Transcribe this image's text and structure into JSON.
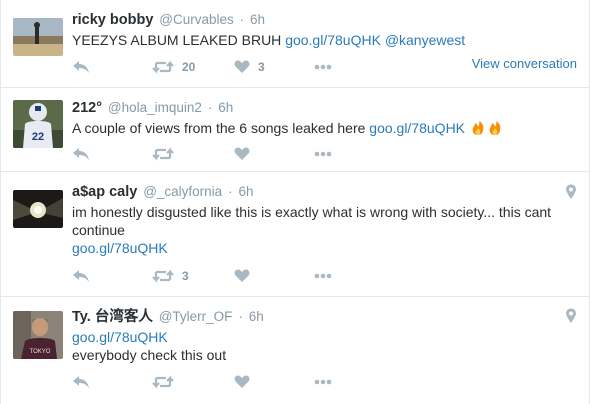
{
  "tweets": [
    {
      "fullname": "ricky bobby",
      "username": "@Curvables",
      "time": "6h",
      "text": "YEEZYS ALBUM LEAKED BRUH ",
      "link": "goo.gl/78uQHK",
      "mention": "@kanyewest",
      "retweets": "20",
      "likes": "3",
      "view_conversation": "View conversation",
      "avatar_icon": "landscape-photo-avatar"
    },
    {
      "fullname": "212°",
      "username": "@hola_imquin2",
      "time": "6h",
      "text": "A couple of views from the 6 songs leaked here ",
      "link": "goo.gl/78uQHK",
      "emoji": "fire-icon",
      "retweets": "",
      "likes": "",
      "avatar_icon": "football-player-avatar"
    },
    {
      "fullname": "a$ap caly",
      "username": "@_calyfornia",
      "time": "6h",
      "text": "im honestly disgusted like this is exactly what is wrong with society... this cant continue",
      "link": "goo.gl/78uQHK",
      "retweets": "3",
      "likes": "",
      "avatar_icon": "dark-light-rays-avatar"
    },
    {
      "fullname": "Ty. 台湾客人",
      "username": "@Tylerr_OF",
      "time": "6h",
      "link": "goo.gl/78uQHK",
      "text": "everybody check this out",
      "retweets": "",
      "likes": "",
      "avatar_icon": "person-selfie-avatar"
    }
  ],
  "separator": "·",
  "colors": {
    "link": "#2b7bb9",
    "secondary_text": "#8899a6",
    "action_icon": "#aab8c2",
    "border": "#e1e8ed"
  }
}
